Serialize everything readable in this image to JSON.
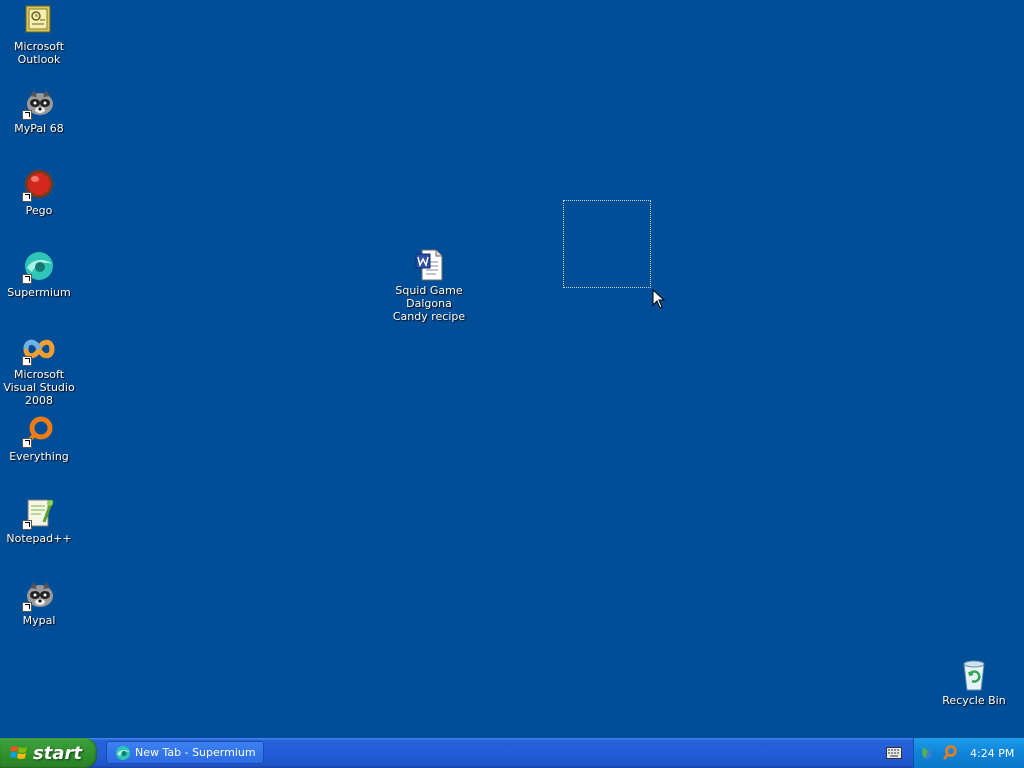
{
  "desktop": {
    "icons": [
      {
        "label": "Microsoft Outlook",
        "icon": "outlook-icon"
      },
      {
        "label": "MyPal 68",
        "icon": "mypal-icon"
      },
      {
        "label": "Pego",
        "icon": "pego-icon"
      },
      {
        "label": "Supermium",
        "icon": "supermium-icon"
      },
      {
        "label": "Microsoft Visual Studio 2008",
        "icon": "visual-studio-icon"
      },
      {
        "label": "Everything",
        "icon": "everything-icon"
      },
      {
        "label": "Notepad++",
        "icon": "notepadpp-icon"
      },
      {
        "label": "Mypal",
        "icon": "mypal-icon"
      },
      {
        "label": "Squid Game Dalgona Candy recipe",
        "icon": "word-document-icon"
      },
      {
        "label": "Recycle Bin",
        "icon": "recycle-bin-icon"
      }
    ]
  },
  "taskbar": {
    "start_label": "start",
    "tasks": [
      {
        "label": "New Tab - Supermium",
        "icon": "supermium-icon"
      }
    ],
    "clock": "4:24 PM"
  },
  "colors": {
    "desktop_bg": "#004e98",
    "taskbar_blue": "#245edb",
    "start_green": "#3c9f3a",
    "tray_blue": "#0f84d8"
  }
}
